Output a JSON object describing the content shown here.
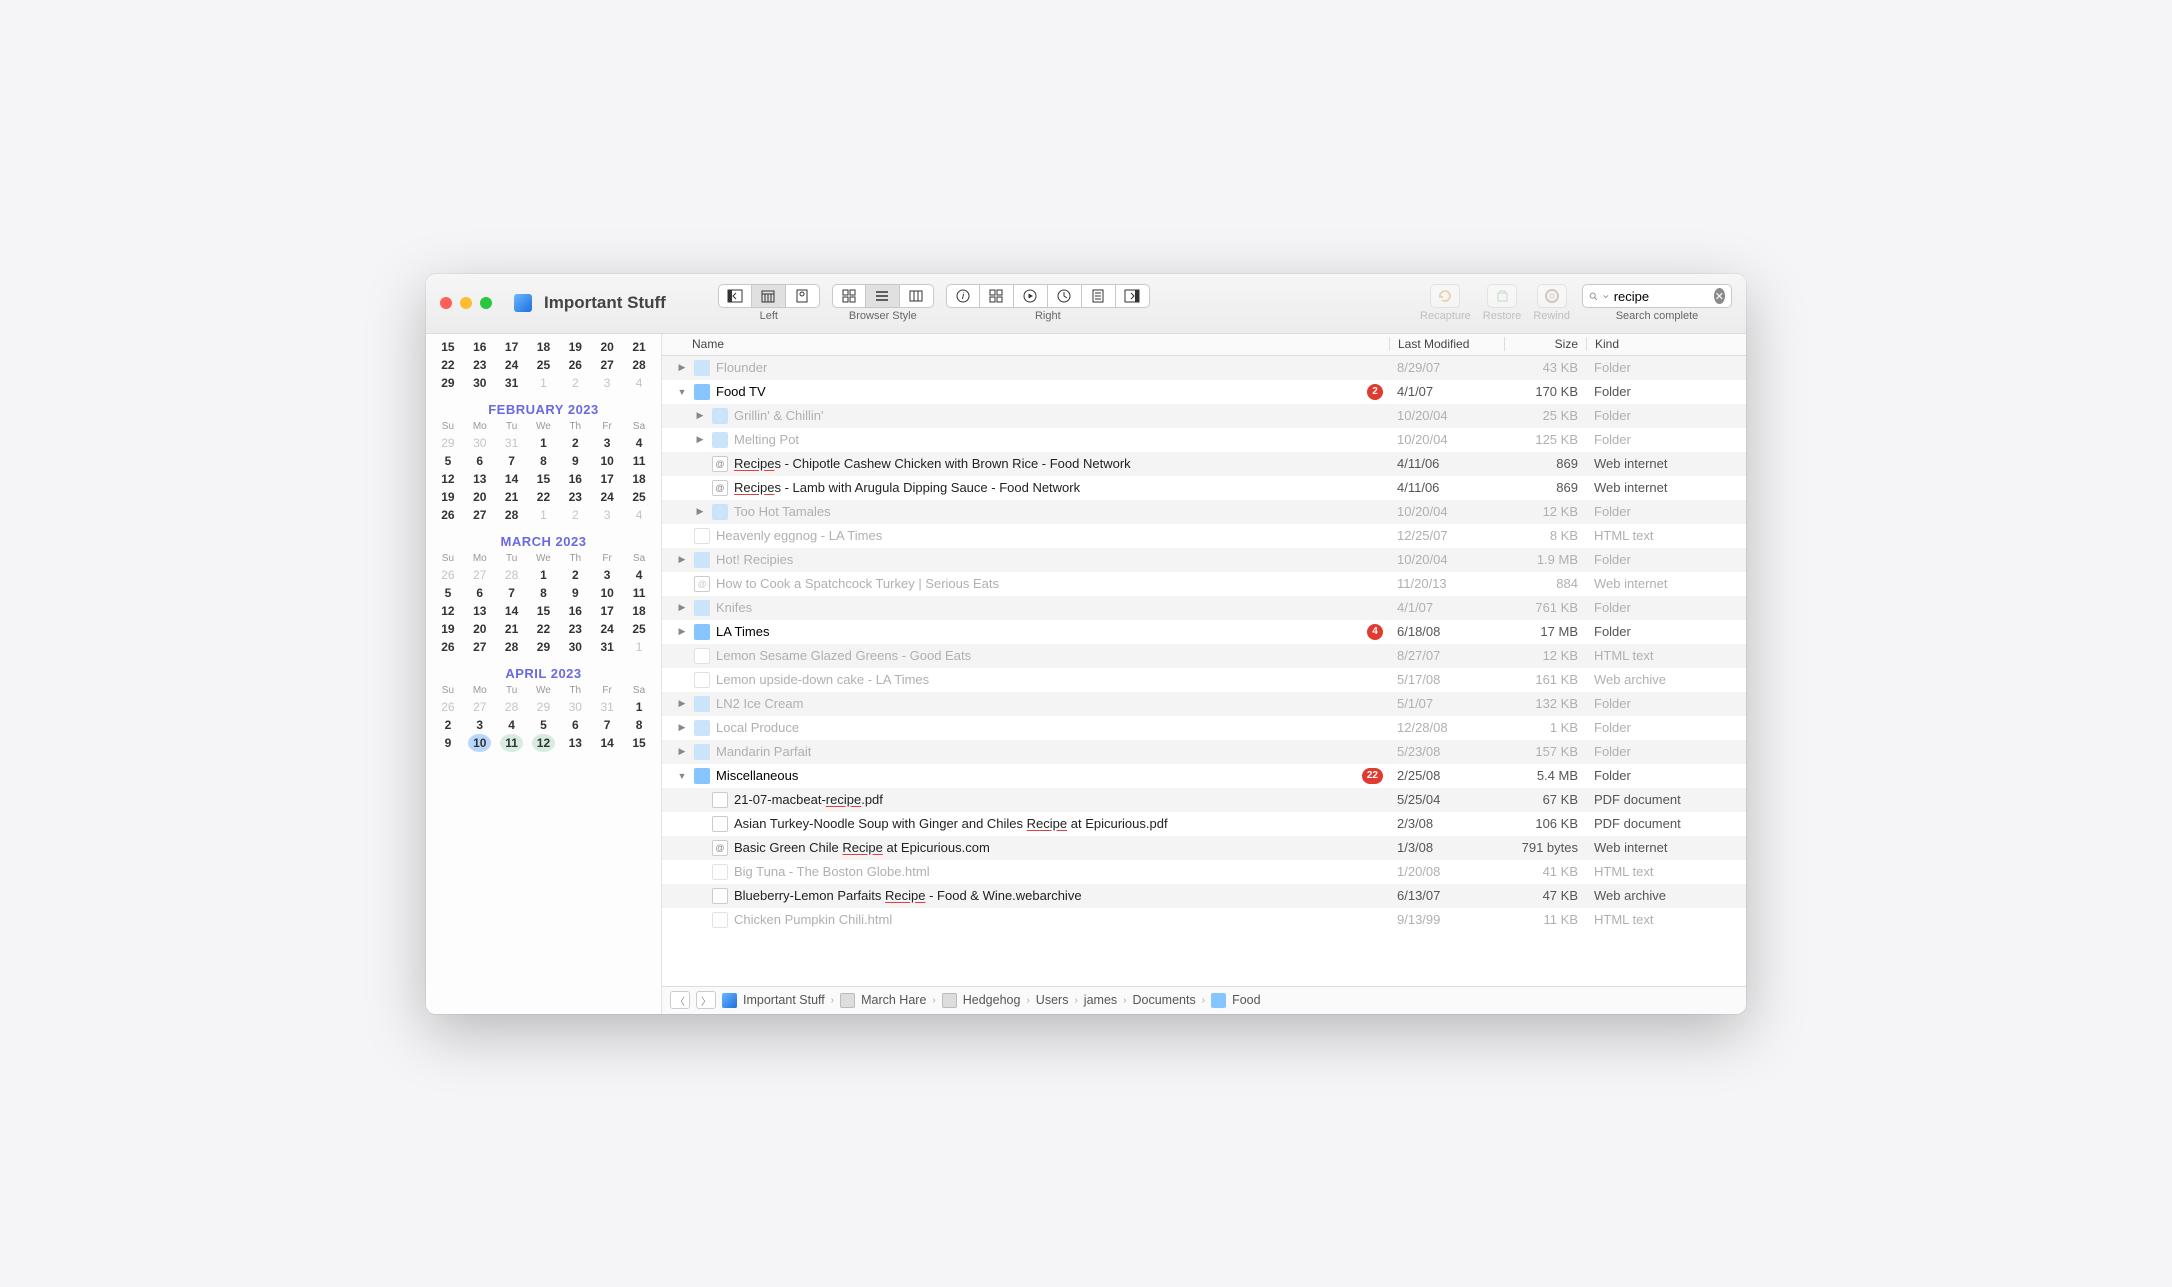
{
  "window_title": "Important Stuff",
  "toolbar": {
    "left_label": "Left",
    "browser_label": "Browser Style",
    "right_label": "Right",
    "recapture": "Recapture",
    "restore": "Restore",
    "rewind": "Rewind"
  },
  "search": {
    "value": "recipe",
    "status": "Search complete"
  },
  "columns": {
    "name": "Name",
    "modified": "Last Modified",
    "size": "Size",
    "kind": "Kind"
  },
  "calendars": [
    {
      "title": null,
      "headers": null,
      "rows": [
        [
          "15",
          "16",
          "17",
          "18",
          "19",
          "20",
          "21"
        ],
        [
          "22",
          "23",
          "24",
          "25",
          "26",
          "27",
          "28"
        ],
        [
          "29",
          "30",
          "31",
          "1",
          "2",
          "3",
          "4"
        ]
      ],
      "dim": [
        [],
        [],
        [
          3,
          4,
          5,
          6
        ]
      ]
    },
    {
      "title": "FEBRUARY 2023",
      "headers": [
        "Su",
        "Mo",
        "Tu",
        "We",
        "Th",
        "Fr",
        "Sa"
      ],
      "rows": [
        [
          "29",
          "30",
          "31",
          "1",
          "2",
          "3",
          "4"
        ],
        [
          "5",
          "6",
          "7",
          "8",
          "9",
          "10",
          "11"
        ],
        [
          "12",
          "13",
          "14",
          "15",
          "16",
          "17",
          "18"
        ],
        [
          "19",
          "20",
          "21",
          "22",
          "23",
          "24",
          "25"
        ],
        [
          "26",
          "27",
          "28",
          "1",
          "2",
          "3",
          "4"
        ]
      ],
      "dim": [
        [
          0,
          1,
          2
        ],
        [],
        [],
        [],
        [
          3,
          4,
          5,
          6
        ]
      ]
    },
    {
      "title": "MARCH 2023",
      "headers": [
        "Su",
        "Mo",
        "Tu",
        "We",
        "Th",
        "Fr",
        "Sa"
      ],
      "rows": [
        [
          "26",
          "27",
          "28",
          "1",
          "2",
          "3",
          "4"
        ],
        [
          "5",
          "6",
          "7",
          "8",
          "9",
          "10",
          "11"
        ],
        [
          "12",
          "13",
          "14",
          "15",
          "16",
          "17",
          "18"
        ],
        [
          "19",
          "20",
          "21",
          "22",
          "23",
          "24",
          "25"
        ],
        [
          "26",
          "27",
          "28",
          "29",
          "30",
          "31",
          "1"
        ]
      ],
      "dim": [
        [
          0,
          1,
          2
        ],
        [],
        [],
        [],
        [
          6
        ]
      ]
    },
    {
      "title": "APRIL 2023",
      "headers": [
        "Su",
        "Mo",
        "Tu",
        "We",
        "Th",
        "Fr",
        "Sa"
      ],
      "rows": [
        [
          "26",
          "27",
          "28",
          "29",
          "30",
          "31",
          "1"
        ],
        [
          "2",
          "3",
          "4",
          "5",
          "6",
          "7",
          "8"
        ],
        [
          "9",
          "10",
          "11",
          "12",
          "13",
          "14",
          "15"
        ]
      ],
      "dim": [
        [
          0,
          1,
          2,
          3,
          4,
          5
        ],
        [],
        []
      ],
      "today": [
        2,
        1
      ],
      "marks": [
        [
          2,
          2
        ],
        [
          2,
          3
        ]
      ]
    }
  ],
  "files": [
    {
      "indent": 0,
      "chev": "right",
      "icon": "folder",
      "faded": true,
      "name": [
        [
          "",
          "Flounder"
        ]
      ],
      "mod": "8/29/07",
      "size": "43 KB",
      "kind": "Folder"
    },
    {
      "indent": 0,
      "chev": "down",
      "icon": "folder",
      "name": [
        [
          "",
          "Food TV"
        ]
      ],
      "badge": "2",
      "mod": "4/1/07",
      "size": "170 KB",
      "kind": "Folder"
    },
    {
      "indent": 1,
      "chev": "right",
      "icon": "folder",
      "faded": true,
      "name": [
        [
          "",
          "Grillin' & Chillin'"
        ]
      ],
      "mod": "10/20/04",
      "size": "25 KB",
      "kind": "Folder"
    },
    {
      "indent": 1,
      "chev": "right",
      "icon": "folder",
      "faded": true,
      "name": [
        [
          "",
          "Melting Pot"
        ]
      ],
      "mod": "10/20/04",
      "size": "125 KB",
      "kind": "Folder"
    },
    {
      "indent": 1,
      "chev": "",
      "icon": "web",
      "result": true,
      "name": [
        [
          "hl",
          "Recipe"
        ],
        [
          "",
          "s - Chipotle Cashew Chicken with Brown Rice - Food Network"
        ]
      ],
      "mod": "4/11/06",
      "size": "869",
      "kind": "Web internet"
    },
    {
      "indent": 1,
      "chev": "",
      "icon": "web",
      "result": true,
      "name": [
        [
          "hl",
          "Recipe"
        ],
        [
          "",
          "s - Lamb with Arugula Dipping Sauce - Food Network"
        ]
      ],
      "mod": "4/11/06",
      "size": "869",
      "kind": "Web internet"
    },
    {
      "indent": 1,
      "chev": "right",
      "icon": "folder",
      "faded": true,
      "name": [
        [
          "",
          "Too Hot Tamales"
        ]
      ],
      "mod": "10/20/04",
      "size": "12 KB",
      "kind": "Folder"
    },
    {
      "indent": 0,
      "chev": "",
      "icon": "doc",
      "faded": true,
      "name": [
        [
          "",
          "Heavenly eggnog - LA Times"
        ]
      ],
      "mod": "12/25/07",
      "size": "8 KB",
      "kind": "HTML text"
    },
    {
      "indent": 0,
      "chev": "right",
      "icon": "folder",
      "faded": true,
      "name": [
        [
          "",
          "Hot! Recipies"
        ]
      ],
      "mod": "10/20/04",
      "size": "1.9 MB",
      "kind": "Folder"
    },
    {
      "indent": 0,
      "chev": "",
      "icon": "web",
      "faded": true,
      "name": [
        [
          "",
          "How to Cook a Spatchcock Turkey | Serious Eats"
        ]
      ],
      "mod": "11/20/13",
      "size": "884",
      "kind": "Web internet"
    },
    {
      "indent": 0,
      "chev": "right",
      "icon": "folder",
      "faded": true,
      "name": [
        [
          "",
          "Knifes"
        ]
      ],
      "mod": "4/1/07",
      "size": "761 KB",
      "kind": "Folder"
    },
    {
      "indent": 0,
      "chev": "right",
      "icon": "folder",
      "name": [
        [
          "",
          "LA Times"
        ]
      ],
      "badge": "4",
      "mod": "6/18/08",
      "size": "17 MB",
      "kind": "Folder"
    },
    {
      "indent": 0,
      "chev": "",
      "icon": "doc",
      "faded": true,
      "name": [
        [
          "",
          "Lemon Sesame Glazed Greens - Good Eats"
        ]
      ],
      "mod": "8/27/07",
      "size": "12 KB",
      "kind": "HTML text"
    },
    {
      "indent": 0,
      "chev": "",
      "icon": "doc",
      "faded": true,
      "name": [
        [
          "",
          "Lemon upside-down cake - LA Times"
        ]
      ],
      "mod": "5/17/08",
      "size": "161 KB",
      "kind": "Web archive"
    },
    {
      "indent": 0,
      "chev": "right",
      "icon": "folder",
      "faded": true,
      "name": [
        [
          "",
          "LN2 Ice Cream"
        ]
      ],
      "mod": "5/1/07",
      "size": "132 KB",
      "kind": "Folder"
    },
    {
      "indent": 0,
      "chev": "right",
      "icon": "folder",
      "faded": true,
      "name": [
        [
          "",
          "Local Produce"
        ]
      ],
      "mod": "12/28/08",
      "size": "1 KB",
      "kind": "Folder"
    },
    {
      "indent": 0,
      "chev": "right",
      "icon": "folder",
      "faded": true,
      "name": [
        [
          "",
          "Mandarin Parfait"
        ]
      ],
      "mod": "5/23/08",
      "size": "157 KB",
      "kind": "Folder"
    },
    {
      "indent": 0,
      "chev": "down",
      "icon": "folder",
      "name": [
        [
          "",
          "Miscellaneous"
        ]
      ],
      "badge": "22",
      "mod": "2/25/08",
      "size": "5.4 MB",
      "kind": "Folder"
    },
    {
      "indent": 1,
      "chev": "",
      "icon": "pdf",
      "result": true,
      "name": [
        [
          "",
          "21-07-macbeat-"
        ],
        [
          "hl",
          "recipe"
        ],
        [
          "",
          ".pdf"
        ]
      ],
      "mod": "5/25/04",
      "size": "67 KB",
      "kind": "PDF document"
    },
    {
      "indent": 1,
      "chev": "",
      "icon": "pdf",
      "result": true,
      "name": [
        [
          "",
          "Asian Turkey-Noodle Soup with Ginger and Chiles "
        ],
        [
          "hl",
          "Recipe"
        ],
        [
          "",
          " at Epicurious.pdf"
        ]
      ],
      "mod": "2/3/08",
      "size": "106 KB",
      "kind": "PDF document"
    },
    {
      "indent": 1,
      "chev": "",
      "icon": "web",
      "result": true,
      "name": [
        [
          "",
          "Basic Green Chile "
        ],
        [
          "hl",
          "Recipe"
        ],
        [
          "",
          " at Epicurious.com"
        ]
      ],
      "mod": "1/3/08",
      "size": "791 bytes",
      "kind": "Web internet"
    },
    {
      "indent": 1,
      "chev": "",
      "icon": "doc",
      "faded": true,
      "name": [
        [
          "",
          "Big Tuna - The Boston Globe.html"
        ]
      ],
      "mod": "1/20/08",
      "size": "41 KB",
      "kind": "HTML text"
    },
    {
      "indent": 1,
      "chev": "",
      "icon": "doc",
      "result": true,
      "name": [
        [
          "",
          "Blueberry-Lemon Parfaits "
        ],
        [
          "hl",
          "Recipe"
        ],
        [
          "",
          " - Food & Wine.webarchive"
        ]
      ],
      "mod": "6/13/07",
      "size": "47 KB",
      "kind": "Web archive"
    },
    {
      "indent": 1,
      "chev": "",
      "icon": "doc",
      "faded": true,
      "name": [
        [
          "",
          "Chicken Pumpkin Chili.html"
        ]
      ],
      "mod": "9/13/99",
      "size": "11 KB",
      "kind": "HTML text"
    }
  ],
  "path": [
    "Important Stuff",
    "March Hare",
    "Hedgehog",
    "Users",
    "james",
    "Documents",
    "Food"
  ]
}
